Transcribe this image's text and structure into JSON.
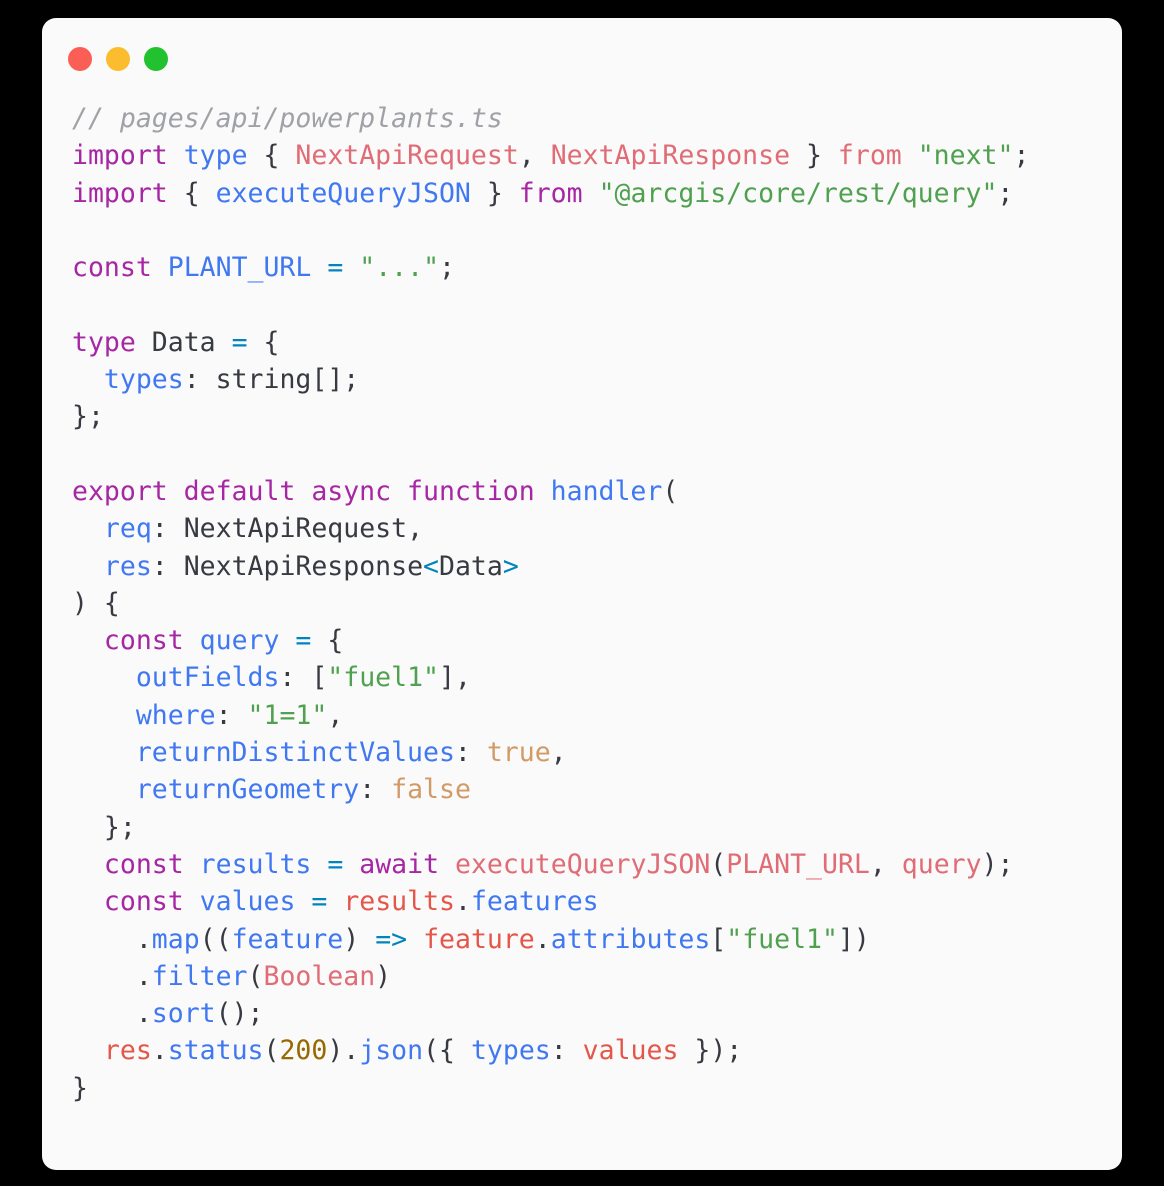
{
  "window": {
    "background": "#fafafa",
    "page_background": "#000000",
    "controls": [
      {
        "name": "close",
        "color": "#fa5e55"
      },
      {
        "name": "minimize",
        "color": "#fbbd2e"
      },
      {
        "name": "maximize",
        "color": "#22c12f"
      }
    ]
  },
  "theme": {
    "comment": "#a0a1a7",
    "keyword": "#a626a4",
    "keyword_blue": "#4078f2",
    "class": "#e06c75",
    "variable": "#e45649",
    "property": "#4078f2",
    "string": "#50a14f",
    "number": "#986801",
    "boolean": "#d19a66",
    "operator": "#0184bc",
    "plain": "#383a42"
  },
  "code": {
    "language": "typescript",
    "filename": "pages/api/powerplants.ts",
    "plain_text": "// pages/api/powerplants.ts\nimport type { NextApiRequest, NextApiResponse } from \"next\";\nimport { executeQueryJSON } from \"@arcgis/core/rest/query\";\n\nconst PLANT_URL = \"...\";\n\ntype Data = {\n  types: string[];\n};\n\nexport default async function handler(\n  req: NextApiRequest,\n  res: NextApiResponse<Data>\n) {\n  const query = {\n    outFields: [\"fuel1\"],\n    where: \"1=1\",\n    returnDistinctValues: true,\n    returnGeometry: false\n  };\n  const results = await executeQueryJSON(PLANT_URL, query);\n  const values = results.features\n    .map((feature) => feature.attributes[\"fuel1\"])\n    .filter(Boolean)\n    .sort();\n  res.status(200).json({ types: values });\n}",
    "lines": [
      {
        "n": 1,
        "tokens": [
          {
            "t": "// pages/api/powerplants.ts",
            "c": "cm"
          }
        ]
      },
      {
        "n": 2,
        "tokens": [
          {
            "t": "import",
            "c": "kw"
          },
          {
            "t": " ",
            "c": "pun"
          },
          {
            "t": "type",
            "c": "kw2"
          },
          {
            "t": " { ",
            "c": "pun"
          },
          {
            "t": "NextApiRequest",
            "c": "cls"
          },
          {
            "t": ", ",
            "c": "pun"
          },
          {
            "t": "NextApiResponse",
            "c": "cls"
          },
          {
            "t": " } ",
            "c": "pun"
          },
          {
            "t": "from",
            "c": "cls"
          },
          {
            "t": " ",
            "c": "pun"
          },
          {
            "t": "\"next\"",
            "c": "str"
          },
          {
            "t": ";",
            "c": "pun"
          }
        ]
      },
      {
        "n": 3,
        "tokens": [
          {
            "t": "import",
            "c": "kw"
          },
          {
            "t": " { ",
            "c": "pun"
          },
          {
            "t": "executeQueryJSON",
            "c": "prop"
          },
          {
            "t": " } ",
            "c": "pun"
          },
          {
            "t": "from",
            "c": "kw"
          },
          {
            "t": " ",
            "c": "pun"
          },
          {
            "t": "\"@arcgis/core/rest/query\"",
            "c": "str"
          },
          {
            "t": ";",
            "c": "pun"
          }
        ]
      },
      {
        "n": 4,
        "tokens": []
      },
      {
        "n": 5,
        "tokens": [
          {
            "t": "const",
            "c": "kw"
          },
          {
            "t": " ",
            "c": "pun"
          },
          {
            "t": "PLANT_URL",
            "c": "prop"
          },
          {
            "t": " ",
            "c": "pun"
          },
          {
            "t": "=",
            "c": "op"
          },
          {
            "t": " ",
            "c": "pun"
          },
          {
            "t": "\"...\"",
            "c": "str"
          },
          {
            "t": ";",
            "c": "pun"
          }
        ]
      },
      {
        "n": 6,
        "tokens": []
      },
      {
        "n": 7,
        "tokens": [
          {
            "t": "type",
            "c": "kw"
          },
          {
            "t": " ",
            "c": "pun"
          },
          {
            "t": "Data",
            "c": "id"
          },
          {
            "t": " ",
            "c": "pun"
          },
          {
            "t": "=",
            "c": "op"
          },
          {
            "t": " {",
            "c": "pun"
          }
        ]
      },
      {
        "n": 8,
        "tokens": [
          {
            "t": "  ",
            "c": "pun"
          },
          {
            "t": "types",
            "c": "prop"
          },
          {
            "t": ": ",
            "c": "pun"
          },
          {
            "t": "string",
            "c": "id"
          },
          {
            "t": "[];",
            "c": "pun"
          }
        ]
      },
      {
        "n": 9,
        "tokens": [
          {
            "t": "};",
            "c": "pun"
          }
        ]
      },
      {
        "n": 10,
        "tokens": []
      },
      {
        "n": 11,
        "tokens": [
          {
            "t": "export default async function",
            "c": "kw"
          },
          {
            "t": " ",
            "c": "pun"
          },
          {
            "t": "handler",
            "c": "prop"
          },
          {
            "t": "(",
            "c": "pun"
          }
        ]
      },
      {
        "n": 12,
        "tokens": [
          {
            "t": "  ",
            "c": "pun"
          },
          {
            "t": "req",
            "c": "prop"
          },
          {
            "t": ": ",
            "c": "pun"
          },
          {
            "t": "NextApiRequest",
            "c": "id"
          },
          {
            "t": ",",
            "c": "pun"
          }
        ]
      },
      {
        "n": 13,
        "tokens": [
          {
            "t": "  ",
            "c": "pun"
          },
          {
            "t": "res",
            "c": "prop"
          },
          {
            "t": ": ",
            "c": "pun"
          },
          {
            "t": "NextApiResponse",
            "c": "id"
          },
          {
            "t": "<",
            "c": "op"
          },
          {
            "t": "Data",
            "c": "id"
          },
          {
            "t": ">",
            "c": "op"
          }
        ]
      },
      {
        "n": 14,
        "tokens": [
          {
            "t": ") {",
            "c": "pun"
          }
        ]
      },
      {
        "n": 15,
        "tokens": [
          {
            "t": "  ",
            "c": "pun"
          },
          {
            "t": "const",
            "c": "kw"
          },
          {
            "t": " ",
            "c": "pun"
          },
          {
            "t": "query",
            "c": "prop"
          },
          {
            "t": " ",
            "c": "pun"
          },
          {
            "t": "=",
            "c": "op"
          },
          {
            "t": " {",
            "c": "pun"
          }
        ]
      },
      {
        "n": 16,
        "tokens": [
          {
            "t": "    ",
            "c": "pun"
          },
          {
            "t": "outFields",
            "c": "prop"
          },
          {
            "t": ": [",
            "c": "pun"
          },
          {
            "t": "\"fuel1\"",
            "c": "str"
          },
          {
            "t": "],",
            "c": "pun"
          }
        ]
      },
      {
        "n": 17,
        "tokens": [
          {
            "t": "    ",
            "c": "pun"
          },
          {
            "t": "where",
            "c": "prop"
          },
          {
            "t": ": ",
            "c": "pun"
          },
          {
            "t": "\"1=1\"",
            "c": "str"
          },
          {
            "t": ",",
            "c": "pun"
          }
        ]
      },
      {
        "n": 18,
        "tokens": [
          {
            "t": "    ",
            "c": "pun"
          },
          {
            "t": "returnDistinctValues",
            "c": "prop"
          },
          {
            "t": ": ",
            "c": "pun"
          },
          {
            "t": "true",
            "c": "bool"
          },
          {
            "t": ",",
            "c": "pun"
          }
        ]
      },
      {
        "n": 19,
        "tokens": [
          {
            "t": "    ",
            "c": "pun"
          },
          {
            "t": "returnGeometry",
            "c": "prop"
          },
          {
            "t": ": ",
            "c": "pun"
          },
          {
            "t": "false",
            "c": "bool"
          }
        ]
      },
      {
        "n": 20,
        "tokens": [
          {
            "t": "  };",
            "c": "pun"
          }
        ]
      },
      {
        "n": 21,
        "tokens": [
          {
            "t": "  ",
            "c": "pun"
          },
          {
            "t": "const",
            "c": "kw"
          },
          {
            "t": " ",
            "c": "pun"
          },
          {
            "t": "results",
            "c": "prop"
          },
          {
            "t": " ",
            "c": "pun"
          },
          {
            "t": "=",
            "c": "op"
          },
          {
            "t": " ",
            "c": "pun"
          },
          {
            "t": "await",
            "c": "kw"
          },
          {
            "t": " ",
            "c": "pun"
          },
          {
            "t": "executeQueryJSON",
            "c": "cls"
          },
          {
            "t": "(",
            "c": "pun"
          },
          {
            "t": "PLANT_URL",
            "c": "cls"
          },
          {
            "t": ", ",
            "c": "pun"
          },
          {
            "t": "query",
            "c": "cls"
          },
          {
            "t": ");",
            "c": "pun"
          }
        ]
      },
      {
        "n": 22,
        "tokens": [
          {
            "t": "  ",
            "c": "pun"
          },
          {
            "t": "const",
            "c": "kw"
          },
          {
            "t": " ",
            "c": "pun"
          },
          {
            "t": "values",
            "c": "prop"
          },
          {
            "t": " ",
            "c": "pun"
          },
          {
            "t": "=",
            "c": "op"
          },
          {
            "t": " ",
            "c": "pun"
          },
          {
            "t": "results",
            "c": "var"
          },
          {
            "t": ".",
            "c": "pun"
          },
          {
            "t": "features",
            "c": "prop"
          }
        ]
      },
      {
        "n": 23,
        "tokens": [
          {
            "t": "    .",
            "c": "pun"
          },
          {
            "t": "map",
            "c": "prop"
          },
          {
            "t": "((",
            "c": "pun"
          },
          {
            "t": "feature",
            "c": "prop"
          },
          {
            "t": ") ",
            "c": "pun"
          },
          {
            "t": "=>",
            "c": "op"
          },
          {
            "t": " ",
            "c": "pun"
          },
          {
            "t": "feature",
            "c": "var"
          },
          {
            "t": ".",
            "c": "pun"
          },
          {
            "t": "attributes",
            "c": "prop"
          },
          {
            "t": "[",
            "c": "pun"
          },
          {
            "t": "\"fuel1\"",
            "c": "str"
          },
          {
            "t": "])",
            "c": "pun"
          }
        ]
      },
      {
        "n": 24,
        "tokens": [
          {
            "t": "    .",
            "c": "pun"
          },
          {
            "t": "filter",
            "c": "prop"
          },
          {
            "t": "(",
            "c": "pun"
          },
          {
            "t": "Boolean",
            "c": "cls"
          },
          {
            "t": ")",
            "c": "pun"
          }
        ]
      },
      {
        "n": 25,
        "tokens": [
          {
            "t": "    .",
            "c": "pun"
          },
          {
            "t": "sort",
            "c": "prop"
          },
          {
            "t": "();",
            "c": "pun"
          }
        ]
      },
      {
        "n": 26,
        "tokens": [
          {
            "t": "  ",
            "c": "pun"
          },
          {
            "t": "res",
            "c": "var"
          },
          {
            "t": ".",
            "c": "pun"
          },
          {
            "t": "status",
            "c": "prop"
          },
          {
            "t": "(",
            "c": "pun"
          },
          {
            "t": "200",
            "c": "num"
          },
          {
            "t": ").",
            "c": "pun"
          },
          {
            "t": "json",
            "c": "prop"
          },
          {
            "t": "({ ",
            "c": "pun"
          },
          {
            "t": "types",
            "c": "prop"
          },
          {
            "t": ": ",
            "c": "pun"
          },
          {
            "t": "values",
            "c": "var"
          },
          {
            "t": " });",
            "c": "pun"
          }
        ]
      },
      {
        "n": 27,
        "tokens": [
          {
            "t": "}",
            "c": "pun"
          }
        ]
      }
    ]
  }
}
